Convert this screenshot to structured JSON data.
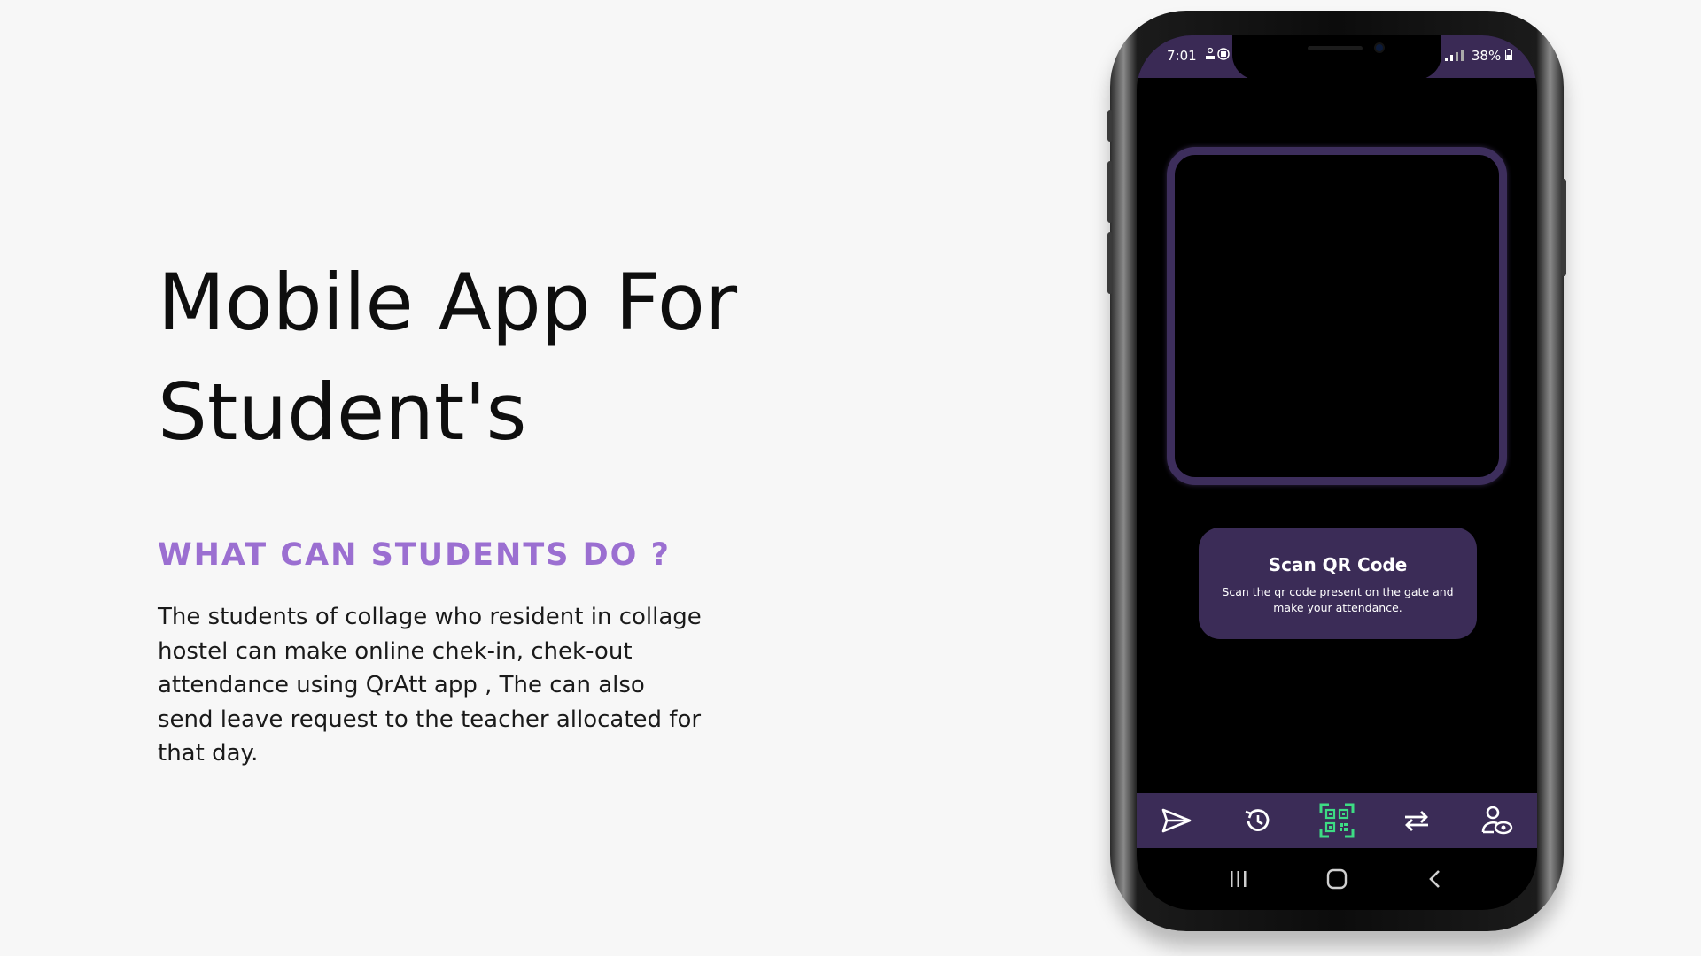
{
  "hero": {
    "title_line1": "Mobile App For",
    "title_line2": "Student's"
  },
  "section": {
    "heading": "WHAT CAN STUDENTS DO ?",
    "description": "The students of collage who resident in collage hostel can make online chek-in, chek-out attendance using QrAtt app , The can also send leave request to the teacher allocated for that day."
  },
  "phone": {
    "status_bar": {
      "time": "7:01",
      "battery": "38%"
    },
    "card": {
      "title": "Scan QR Code",
      "subtitle": "Scan the qr code present on the gate and make your attendance."
    },
    "bottom_nav": {
      "items": [
        {
          "icon": "send-icon"
        },
        {
          "icon": "history-icon"
        },
        {
          "icon": "qr-code-icon",
          "active": true
        },
        {
          "icon": "swap-icon"
        },
        {
          "icon": "profile-view-icon"
        }
      ]
    },
    "system_nav": {
      "items": [
        {
          "icon": "recents-icon"
        },
        {
          "icon": "home-icon"
        },
        {
          "icon": "back-icon"
        }
      ]
    }
  },
  "colors": {
    "accent_heading": "#9b6fd1",
    "app_purple": "#3b2c57",
    "qr_active": "#3ddc84"
  }
}
